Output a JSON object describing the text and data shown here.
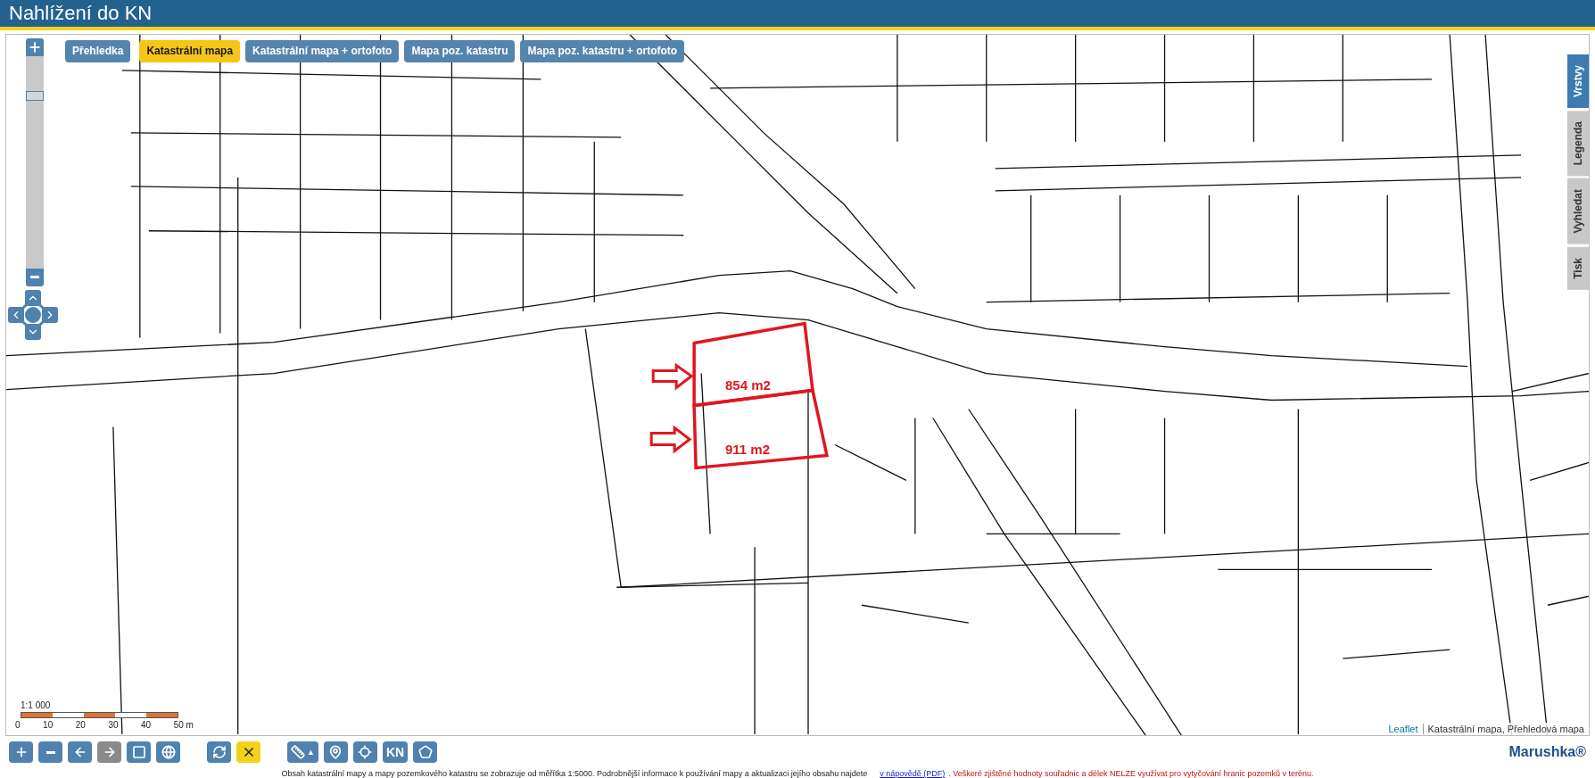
{
  "header": {
    "title": "Nahlížení do KN"
  },
  "map_layers": [
    {
      "label": "Přehledka",
      "selected": false
    },
    {
      "label": "Katastrální mapa",
      "selected": true
    },
    {
      "label": "Katastrální mapa + ortofoto",
      "selected": false
    },
    {
      "label": "Mapa poz. katastru",
      "selected": false
    },
    {
      "label": "Mapa poz. katastru + ortofoto",
      "selected": false
    }
  ],
  "zoom_slider": {
    "level": 0.83
  },
  "side_tabs": [
    {
      "label": "Vrstvy",
      "selected": true
    },
    {
      "label": "Legenda",
      "selected": false
    },
    {
      "label": "Vyhledat",
      "selected": false
    },
    {
      "label": "Tisk",
      "selected": false
    }
  ],
  "annotations": [
    {
      "area": "854 m2"
    },
    {
      "area": "911 m2"
    }
  ],
  "scale": {
    "ratio": "1:1 000",
    "ticks": [
      "0",
      "10",
      "20",
      "30",
      "40",
      "50 m"
    ]
  },
  "attribution": {
    "link": "Leaflet",
    "text": "Katastrální mapa, Přehledová mapa"
  },
  "toolbar": [
    [
      {
        "kind": "zoom-in",
        "disabled": false,
        "highlighted": false
      },
      {
        "kind": "zoom-out",
        "disabled": false,
        "highlighted": false
      },
      {
        "kind": "back",
        "disabled": false,
        "highlighted": false
      },
      {
        "kind": "forward",
        "disabled": true,
        "highlighted": false
      },
      {
        "kind": "zoom-box",
        "disabled": false,
        "highlighted": false
      },
      {
        "kind": "globe",
        "disabled": false,
        "highlighted": false
      }
    ],
    [
      {
        "kind": "refresh",
        "disabled": false,
        "highlighted": false
      },
      {
        "kind": "clear",
        "disabled": false,
        "highlighted": true
      }
    ],
    [
      {
        "kind": "measure",
        "disabled": false,
        "highlighted": false,
        "caret": "▲"
      },
      {
        "kind": "gps",
        "disabled": false,
        "highlighted": false
      },
      {
        "kind": "locate",
        "disabled": false,
        "highlighted": false
      },
      {
        "kind": "kn",
        "disabled": false,
        "highlighted": false,
        "label": "KN"
      },
      {
        "kind": "polygon",
        "disabled": false,
        "highlighted": false
      }
    ]
  ],
  "brand": "Marushka®",
  "footer": {
    "info": "Obsah katastrální mapy a mapy pozemkového katastru se zobrazuje od měřítka 1:5000. Podrobnější informace k používání mapy a aktualizaci jejího obsahu najdete",
    "link": "v nápovědě (PDF)",
    "warning": ". Veškeré zjištěné hodnoty souřadnic a délek NELZE využívat pro vytyčování hranic pozemků v terénu."
  }
}
